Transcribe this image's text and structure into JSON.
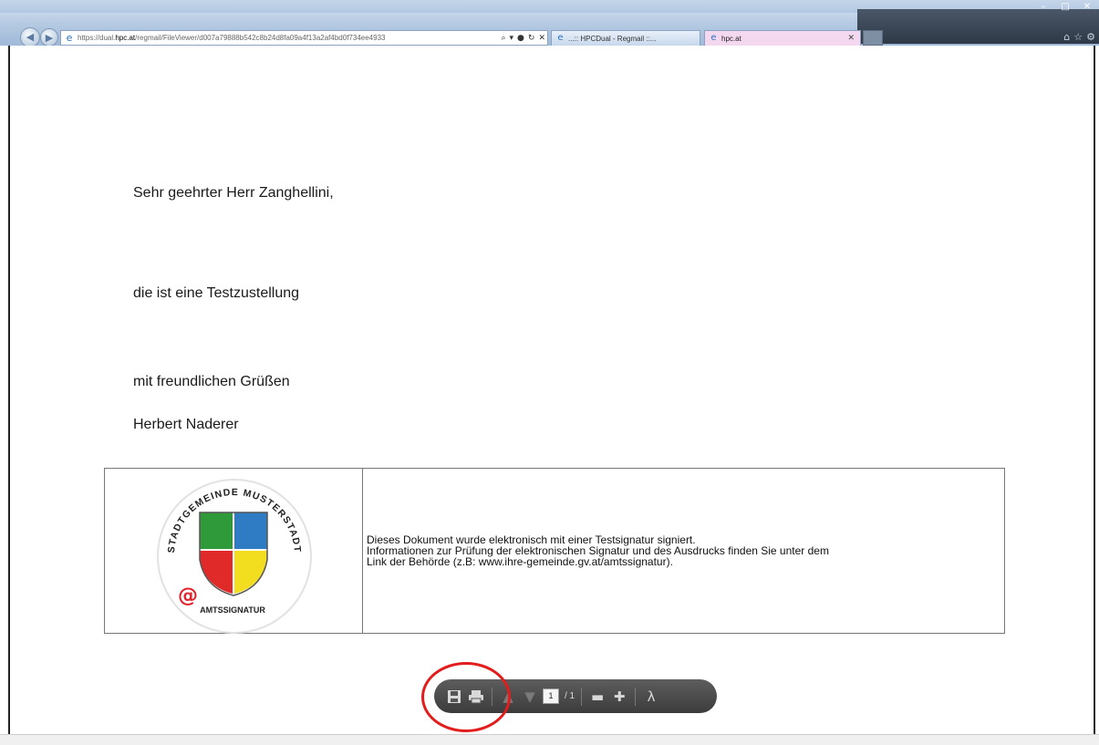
{
  "browser": {
    "url_prefix": "https://dual.",
    "url_host": "hpc.at",
    "url_path": "/regmail/FileViewer/d007a79888b542c8b24d8fa09a4f13a2af4bd0f734ee4933",
    "tabs": [
      {
        "label": "...:: HPCDual - Regmail ::..."
      },
      {
        "label": "hpc.at"
      }
    ],
    "window_buttons": [
      "–",
      "□",
      "✕"
    ],
    "right_icons": [
      "⌂",
      "☆",
      "⚙"
    ]
  },
  "letter": {
    "greeting": "Sehr geehrter Herr Zanghellini,",
    "body": "die ist eine Testzustellung",
    "closing": "mit freundlichen Grüßen",
    "signature": "Herbert Naderer"
  },
  "seal": {
    "ring_text": "STADTGEMEINDE MUSTERSTADT",
    "label": "AMTSSIGNATUR",
    "at_symbol": "@",
    "colors": {
      "green": "#2f9a3a",
      "blue": "#2f7cc5",
      "red": "#e02a2a",
      "yellow": "#f3dd1f",
      "at_red": "#e2232b"
    }
  },
  "signature_notice": {
    "line1": "Dieses Dokument wurde elektronisch mit einer Testsignatur signiert.",
    "line2": "Informationen zur Prüfung der elektronischen Signatur und des Ausdrucks finden Sie unter dem",
    "line3": "Link der Behörde (z.B:  www.ihre-gemeinde.gv.at/amtssignatur)."
  },
  "pdf_toolbar": {
    "page_current": "1",
    "page_total": "/ 1",
    "icons": [
      "save-icon",
      "print-icon",
      "arrow-up-icon",
      "arrow-down-icon",
      "zoom-out-icon",
      "zoom-in-icon",
      "adobe-icon"
    ]
  },
  "annotation": {
    "ring_color": "#e31c1c"
  }
}
